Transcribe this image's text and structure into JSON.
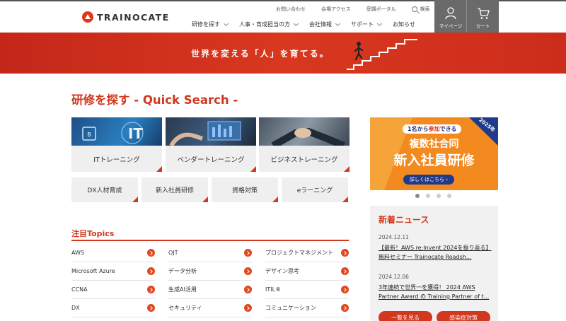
{
  "header": {
    "logo_text": "TRAINOCATE",
    "util_links": [
      "お問い合わせ",
      "会場アクセス",
      "受講ポータル"
    ],
    "search_label": "検索",
    "nav": [
      "研修を探す",
      "人事・育成担当の方",
      "会社情報",
      "サポート",
      "お知らせ"
    ],
    "mypage_label": "マイページ",
    "cart_label": "カート"
  },
  "banner": {
    "tagline": "世界を変える「人」を育てる。"
  },
  "quick_search": {
    "title": "研修を探す - Quick Search -",
    "tiles": [
      {
        "label": "ITトレーニング",
        "icon": "chip-icon"
      },
      {
        "label": "ベンダートレーニング",
        "icon": "laptop-icon"
      },
      {
        "label": "ビジネストレーニング",
        "icon": "handshake-icon"
      }
    ],
    "small_tiles": [
      "DX人材育成",
      "新入社員研修",
      "資格対策",
      "eラーニング"
    ]
  },
  "topics": {
    "title": "注目Topics",
    "columns": [
      [
        "AWS",
        "Microsoft Azure",
        "CCNA",
        "DX"
      ],
      [
        "OJT",
        "データ分析",
        "生成AI活用",
        "セキュリティ"
      ],
      [
        "プロジェクトマネジメント",
        "デザイン思考",
        "ITIL®",
        "コミュニケーション"
      ]
    ]
  },
  "promo": {
    "badge_prefix": "1名から",
    "badge_highlight": "参加",
    "badge_suffix": "できる",
    "year": "2025年",
    "line1": "複数社合同",
    "line2": "新入社員研修",
    "cta": "詳しくはこちら ›"
  },
  "news": {
    "title": "新着ニュース",
    "items": [
      {
        "date": "2024.12.11",
        "text": "【最新！AWS re:Invent 2024を振り返る】無料セミナー Trainocate Roadsh..."
      },
      {
        "date": "2024.12.06",
        "text": "3年連続で世界一を獲得！ 2024 AWS Partner Award の Training Partner of t..."
      }
    ],
    "list_button": "一覧を見る",
    "infection_button": "感染症対策"
  },
  "colors": {
    "accent": "#d1381e",
    "header_button": "#6a6a6a",
    "promo": "#f28a1f"
  }
}
